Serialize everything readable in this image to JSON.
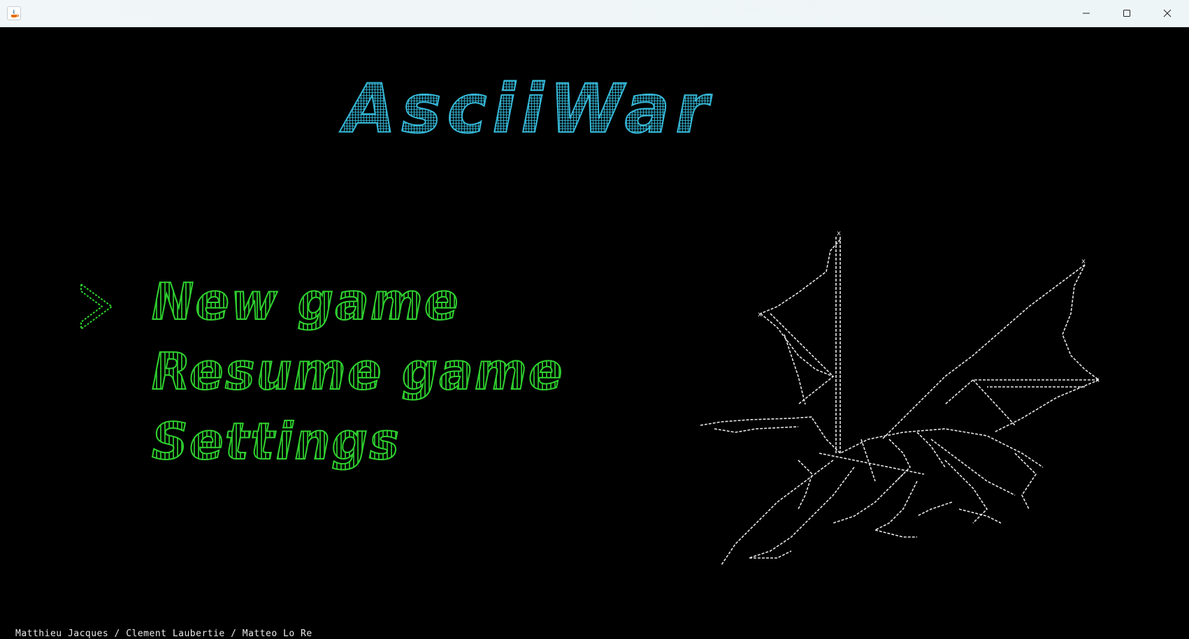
{
  "window": {
    "title": "",
    "controls": [
      "minimize-icon",
      "maximize-icon",
      "close-icon"
    ]
  },
  "game": {
    "title": "AsciiWar",
    "menu": {
      "cursor": ">",
      "items": [
        "New game",
        "Resume game",
        "Settings"
      ],
      "selected_index": 0
    },
    "credits": "Matthieu Jacques / Clement Laubertie / Matteo Lo Re"
  },
  "colors": {
    "title": "#35b7d6",
    "menu": "#2fd12f",
    "art": "#ffffff",
    "background": "#000000"
  }
}
